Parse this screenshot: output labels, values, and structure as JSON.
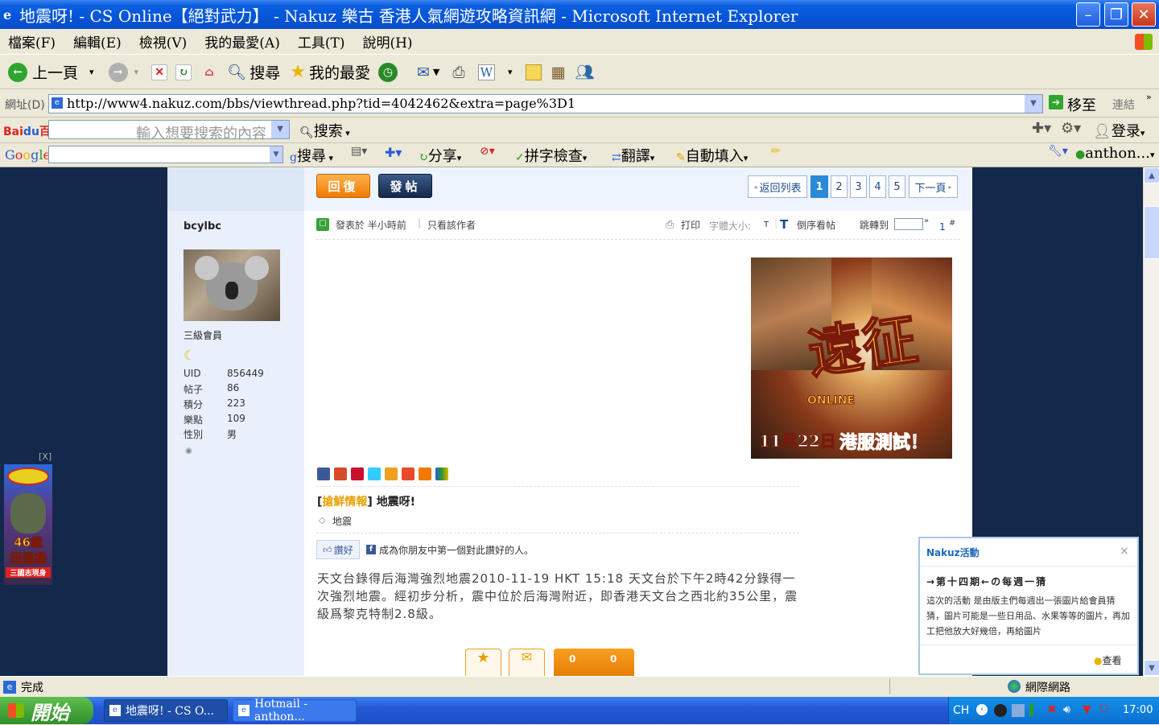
{
  "window": {
    "title": "地震呀! - CS Online【絕對武力】 - Nakuz 樂古 香港人氣網遊攻略資訊網 - Microsoft Internet Explorer"
  },
  "menu": [
    "檔案(F)",
    "編輯(E)",
    "檢視(V)",
    "我的最愛(A)",
    "工具(T)",
    "說明(H)"
  ],
  "toolbar": {
    "back": "上一頁",
    "search": "搜尋",
    "favorites": "我的最愛"
  },
  "address": {
    "label": "網址(D)",
    "url": "http://www4.nakuz.com/bbs/viewthread.php?tid=4042462&extra=page%3D1",
    "go": "移至",
    "links": "連結"
  },
  "baidu": {
    "placeholder": "輸入想要搜索的內容",
    "search": "搜索",
    "login": "登录"
  },
  "google": {
    "search": "搜尋",
    "share": "分享",
    "spellcheck": "拼字檢查",
    "translate": "翻譯",
    "autofill": "自動填入",
    "account": "anthon..."
  },
  "thread": {
    "reply_btn": "回復",
    "post_btn": "發帖",
    "back_to_list": "返回列表",
    "pages": [
      "1",
      "2",
      "3",
      "4",
      "5"
    ],
    "next": "下一頁",
    "posted": "發表於 半小時前",
    "only_author": "只看該作者",
    "print": "打印",
    "font_size": "字體大小:",
    "font_t": "T",
    "reverse": "倒序看帖",
    "jump": "跳轉到",
    "floor": "1",
    "floor_mark": "#",
    "category": "搶鮮情報",
    "title": "地震呀!",
    "tag": "地震",
    "like": "讚好",
    "fb_text": "成為你朋友中第一個對此讚好的人。",
    "body": "天文台錄得后海灣強烈地震2010-11-19 HKT 15:18 天文台於下午2時42分錄得一次強烈地震。經初步分析，震中位於后海灣附近，即香港天文台之西北約35公里，震級爲黎克特制2.8級。",
    "fav_count": "0",
    "share_count": "0"
  },
  "user": {
    "name": "bcylbc",
    "rank": "三級會員",
    "stats": [
      {
        "k": "UID",
        "v": "856449"
      },
      {
        "k": "帖子",
        "v": "86"
      },
      {
        "k": "積分",
        "v": "223"
      },
      {
        "k": "樂點",
        "v": "109"
      },
      {
        "k": "性別",
        "v": "男"
      }
    ]
  },
  "ad": {
    "close": "[X]",
    "line1": "46歲",
    "line2": "扭蛋機",
    "line3": "三國志現身",
    "banner_logo": "ONLINE",
    "banner_date": "11月22日",
    "banner_text": "港服測試！"
  },
  "popup": {
    "title": "Nakuz活動",
    "close": "×",
    "heading": "→第十四期←の每週一猜",
    "text": "這次的活動 是由版主們每週出一張圖片給會員猜猜，圖片可能是一些日用品、水果等等的圖片，再加工把他放大好幾倍，再給圖片",
    "view": "查看"
  },
  "status": {
    "text": "完成",
    "zone": "網際網路"
  },
  "taskbar": {
    "start": "開始",
    "tasks": [
      "地震呀! - CS O...",
      "Hotmail - anthon..."
    ],
    "lang": "CH",
    "clock": "17:00"
  }
}
